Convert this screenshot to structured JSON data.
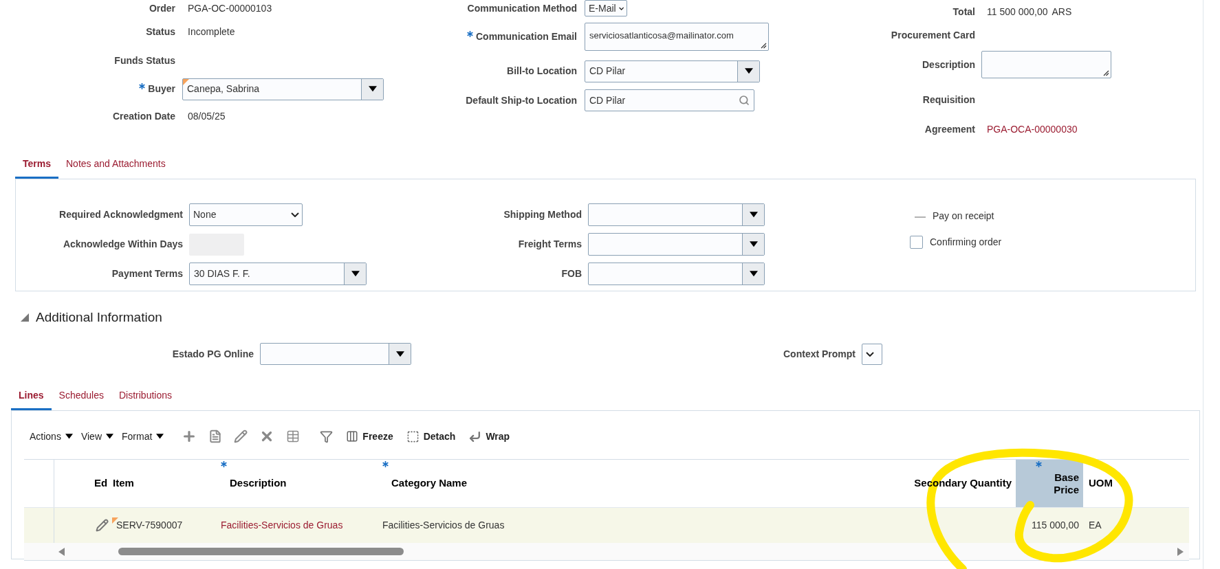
{
  "order_header": {
    "columns": [
      [
        {
          "label": "Order",
          "kind": "text",
          "required": false,
          "changed": false,
          "value": "PGA-OC-00000103"
        },
        {
          "label": "Status",
          "kind": "text",
          "required": false,
          "changed": false,
          "value": "Incomplete"
        },
        {
          "label": "Funds Status",
          "kind": "text",
          "required": false,
          "changed": false
        },
        {
          "label": "Buyer",
          "kind": "select",
          "required": true,
          "changed": true,
          "value": "Canepa, Sabrina"
        },
        {
          "label": "Creation Date",
          "kind": "text",
          "required": false,
          "changed": false,
          "value": "08/05/25"
        }
      ],
      [
        {
          "label": "Communication Method",
          "kind": "choice",
          "required": false,
          "changed": false,
          "value": "E-Mail"
        },
        {
          "label": "Communication Email",
          "kind": "textarea",
          "required": true,
          "changed": false,
          "value": "serviciosatlanticosa@mailinator.com"
        },
        {
          "label": "Bill-to Location",
          "kind": "select",
          "required": false,
          "changed": false,
          "value": "CD Pilar"
        },
        {
          "label": "Default Ship-to Location",
          "kind": "search",
          "required": false,
          "changed": false,
          "value": "CD Pilar"
        }
      ],
      [
        {
          "label": "Total",
          "kind": "amount",
          "required": false,
          "changed": false,
          "value": "11 500 000,00",
          "currency": "ARS"
        },
        {
          "label": "Procurement Card",
          "kind": "text",
          "required": false,
          "changed": false
        },
        {
          "label": "Description",
          "kind": "textarea",
          "required": false,
          "changed": false
        },
        {
          "label": "Requisition",
          "kind": "text",
          "required": false,
          "changed": false
        },
        {
          "label": "Agreement",
          "kind": "link",
          "required": false,
          "changed": false,
          "value": "PGA-OCA-00000030"
        }
      ]
    ]
  },
  "terms_tabs": [
    {
      "label": "Terms",
      "selected": true
    },
    {
      "label": "Notes and Attachments",
      "selected": false
    }
  ],
  "terms": {
    "columns": [
      [
        {
          "label": "Required Acknowledgment",
          "kind": "choice",
          "required": false,
          "changed": false,
          "value": "None"
        },
        {
          "label": "Acknowledge Within Days",
          "kind": "readonly",
          "required": false,
          "changed": false
        },
        {
          "label": "Payment Terms",
          "kind": "select",
          "required": false,
          "changed": false,
          "value": "30 DIAS F. F."
        }
      ],
      [
        {
          "label": "Shipping Method",
          "kind": "select",
          "required": false,
          "changed": false
        },
        {
          "label": "Freight Terms",
          "kind": "select",
          "required": false,
          "changed": false
        },
        {
          "label": "FOB",
          "kind": "select",
          "required": false,
          "changed": false
        }
      ]
    ],
    "options": [
      {
        "label": "Pay on receipt",
        "kind": "readonly",
        "checked": false
      },
      {
        "label": "Confirming order",
        "kind": "checkbox",
        "checked": false
      }
    ]
  },
  "additional_information": {
    "title": "Additional Information",
    "expanded": true,
    "fields": [
      {
        "label": "Estado PG Online",
        "kind": "select",
        "required": false,
        "changed": false
      },
      {
        "label": "Context Prompt",
        "kind": "choice",
        "required": false,
        "changed": false
      }
    ]
  },
  "lines_tabs": [
    {
      "label": "Lines",
      "selected": true
    },
    {
      "label": "Schedules",
      "selected": false
    },
    {
      "label": "Distributions",
      "selected": false
    }
  ],
  "toolbar": {
    "menus": [
      "Actions",
      "View",
      "Format"
    ],
    "tools": [
      {
        "kind": "add"
      },
      {
        "kind": "duplicate"
      },
      {
        "kind": "edit"
      },
      {
        "kind": "delete"
      },
      {
        "kind": "export"
      },
      {
        "kind": "filter"
      },
      {
        "kind": "freeze",
        "label": "Freeze"
      },
      {
        "kind": "detach",
        "label": "Detach"
      },
      {
        "kind": "wrap",
        "label": "Wrap"
      }
    ]
  },
  "table": {
    "columns": [
      {
        "label": "Ed",
        "required": false,
        "selected": false
      },
      {
        "label": "Item",
        "required": false,
        "selected": false
      },
      {
        "label": "Description",
        "required": true,
        "selected": false
      },
      {
        "label": "Category Name",
        "required": true,
        "selected": false
      },
      {
        "label": "Secondary Quantity",
        "required": false,
        "selected": false
      },
      {
        "label": "Base Price",
        "required": true,
        "selected": true
      },
      {
        "label": "UOM",
        "required": false,
        "selected": false
      }
    ],
    "rows": [
      {
        "selected": true,
        "item": "SERV-7590007",
        "item_changed": true,
        "description": "Facilities-Servicios de Gruas",
        "category": "Facilities-Servicios de Gruas",
        "base_price": "115 000,00",
        "uom": "EA"
      }
    ]
  }
}
